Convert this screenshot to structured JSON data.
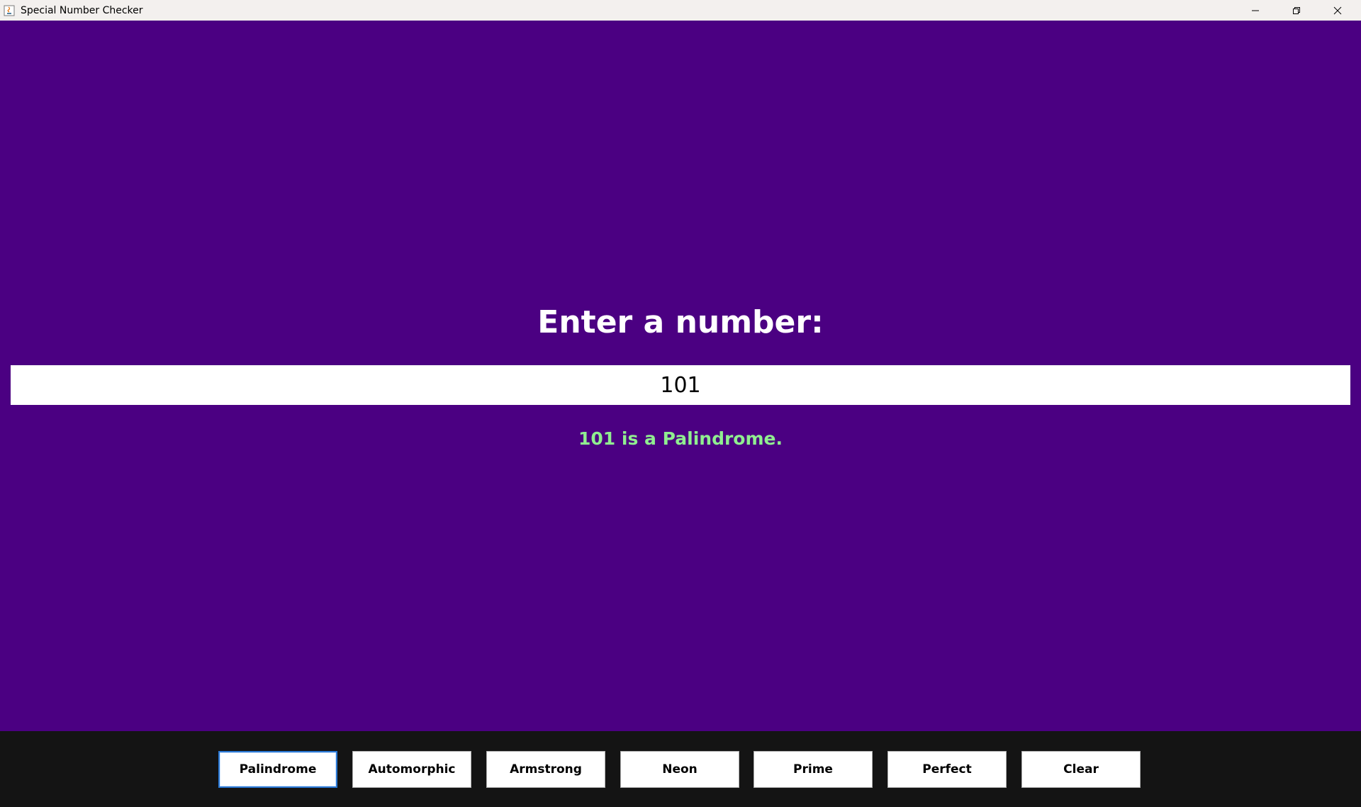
{
  "window": {
    "title": "Special Number Checker",
    "controls": {
      "minimize": "minimize-icon",
      "restore": "restore-icon",
      "close": "close-icon"
    }
  },
  "main": {
    "prompt": "Enter a number:",
    "input_value": "101",
    "result": "101 is a Palindrome."
  },
  "buttons": [
    {
      "label": "Palindrome",
      "focused": true
    },
    {
      "label": "Automorphic",
      "focused": false
    },
    {
      "label": "Armstrong",
      "focused": false
    },
    {
      "label": "Neon",
      "focused": false
    },
    {
      "label": "Prime",
      "focused": false
    },
    {
      "label": "Perfect",
      "focused": false
    },
    {
      "label": "Clear",
      "focused": false
    }
  ],
  "colors": {
    "background": "#4b0082",
    "prompt_text": "#ffffff",
    "result_text": "#90ee90",
    "button_bar": "#141414",
    "focus_border": "#2a78d4"
  }
}
